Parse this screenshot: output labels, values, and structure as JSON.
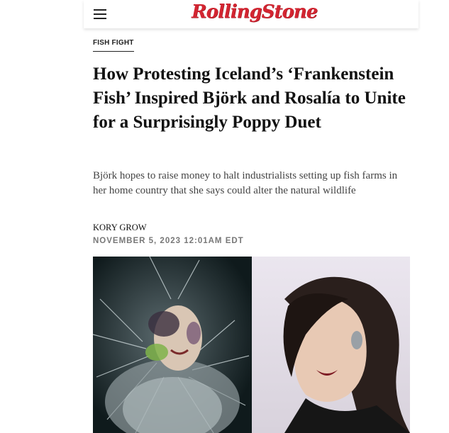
{
  "header": {
    "logo_text": "RollingStone"
  },
  "article": {
    "kicker": "FISH FIGHT",
    "headline": "How Protesting Iceland’s ‘Frankenstein Fish’ Inspired Björk and Rosalía to Unite for a Surprisingly Poppy Duet",
    "dek": "Björk hopes to raise money to halt industrialists setting up fish farms in her home country that she says could alter the natural wildlife",
    "author": "KORY GROW",
    "date": "NOVEMBER 5, 2023 12:01AM EDT"
  },
  "colors": {
    "brand": "#d32531"
  }
}
